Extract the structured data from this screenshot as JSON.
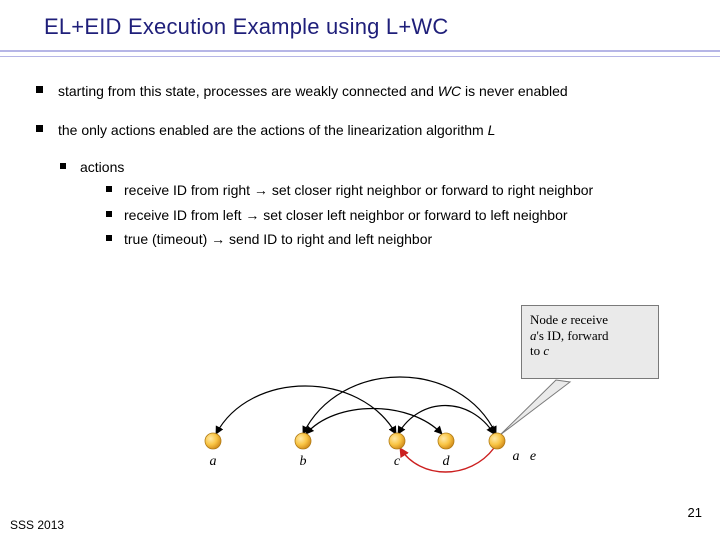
{
  "title": "EL+EID Execution Example using L+WC",
  "bullets": {
    "b1_pre": "starting from this state, processes are weakly connected and ",
    "b1_wc": "WC",
    "b1_post": " is never enabled",
    "b2_pre": "the only actions enabled are the actions of the linearization algorithm ",
    "b2_L": "L",
    "actions_label": "actions",
    "a1": "receive ID from right → set closer right neighbor or forward to right neighbor",
    "a2": "receive ID from left → set closer left neighbor or forward to left neighbor",
    "a3": "true (timeout) → send ID to right and left neighbor"
  },
  "callout": {
    "line1_pre": "Node ",
    "line1_e": "e",
    "line1_post": " receive",
    "line2_a": "a",
    "line2_post": "'s ID, forward",
    "line3_pre": "to ",
    "line3_c": "c"
  },
  "nodes": {
    "a": "a",
    "b": "b",
    "c": "c",
    "d": "d",
    "e": "e",
    "a2": "a"
  },
  "footer": {
    "page": "21",
    "conf": "SSS 2013"
  },
  "colors": {
    "title": "#1f1f7a",
    "rule": "#b6b6e6",
    "node_fill": "#f9c544",
    "node_grad": "#d18a1a",
    "arc_black": "#000000",
    "arc_red": "#cc1f1f",
    "callout_bg": "#eaeaea"
  }
}
